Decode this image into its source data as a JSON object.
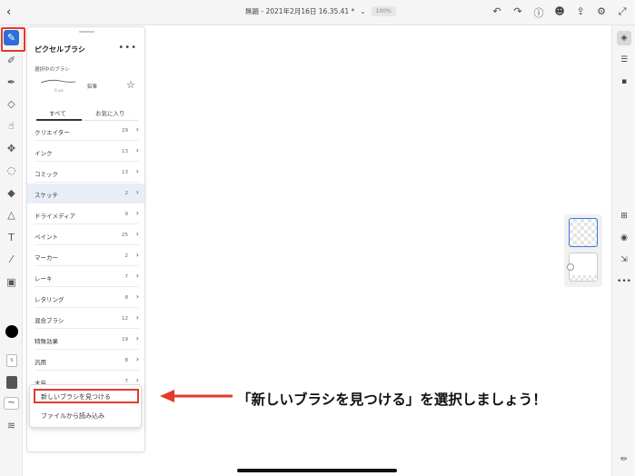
{
  "topbar": {
    "back_glyph": "‹",
    "doc_title": "無題 - 2021年2月16日 16.35.41 *",
    "chevron": "⌄",
    "zoom": "100%",
    "icons": [
      "undo-icon",
      "redo-icon",
      "help-icon",
      "user-add-icon",
      "share-icon",
      "gear-icon",
      "fullscreen-icon"
    ]
  },
  "left_tools": {
    "icons": [
      "pixel-brush-icon",
      "live-brush-icon",
      "vector-brush-icon",
      "eraser-icon",
      "smudge-icon",
      "transform-icon",
      "lasso-icon",
      "fill-icon",
      "shape-icon",
      "text-icon",
      "eyedropper-icon",
      "image-icon"
    ],
    "size_value": "6"
  },
  "panel": {
    "title": "ピクセルブラシ",
    "more": "•••",
    "selected_label": "選択中のブラシ",
    "stroke_size": "6 px",
    "brush_name": "鉛筆",
    "tabs": {
      "all": "すべて",
      "favorites": "お気に入り"
    },
    "categories": [
      {
        "name": "クリエイター",
        "count": "29"
      },
      {
        "name": "インク",
        "count": "13"
      },
      {
        "name": "コミック",
        "count": "13"
      },
      {
        "name": "スケッチ",
        "count": "2",
        "selected": true
      },
      {
        "name": "ドライメディア",
        "count": "9"
      },
      {
        "name": "ペイント",
        "count": "25"
      },
      {
        "name": "マーカー",
        "count": "2"
      },
      {
        "name": "レーキ",
        "count": "7"
      },
      {
        "name": "レタリング",
        "count": "8"
      },
      {
        "name": "混合ブラシ",
        "count": "12"
      },
      {
        "name": "特殊効果",
        "count": "19"
      },
      {
        "name": "汎用",
        "count": "8"
      },
      {
        "name": "木炭",
        "count": "7"
      }
    ],
    "chevron": "›",
    "plus": "+"
  },
  "popup": {
    "find_new": "新しいブラシを見つける",
    "load_file": "ファイルから読み込み"
  },
  "annotation": {
    "text": "「新しいブラシを見つける」を選択しましょう！",
    "color": "#e53a2a"
  },
  "right_tools": {
    "icons": [
      "layers-icon",
      "adjust-icon",
      "comment-icon",
      "add-layer-icon",
      "visibility-icon",
      "import-icon",
      "more-icon",
      "pencil-icon"
    ]
  },
  "colors": {
    "accent": "#2c6fd6",
    "highlight": "#e53a2a",
    "selected_row": "#e8eef8"
  }
}
